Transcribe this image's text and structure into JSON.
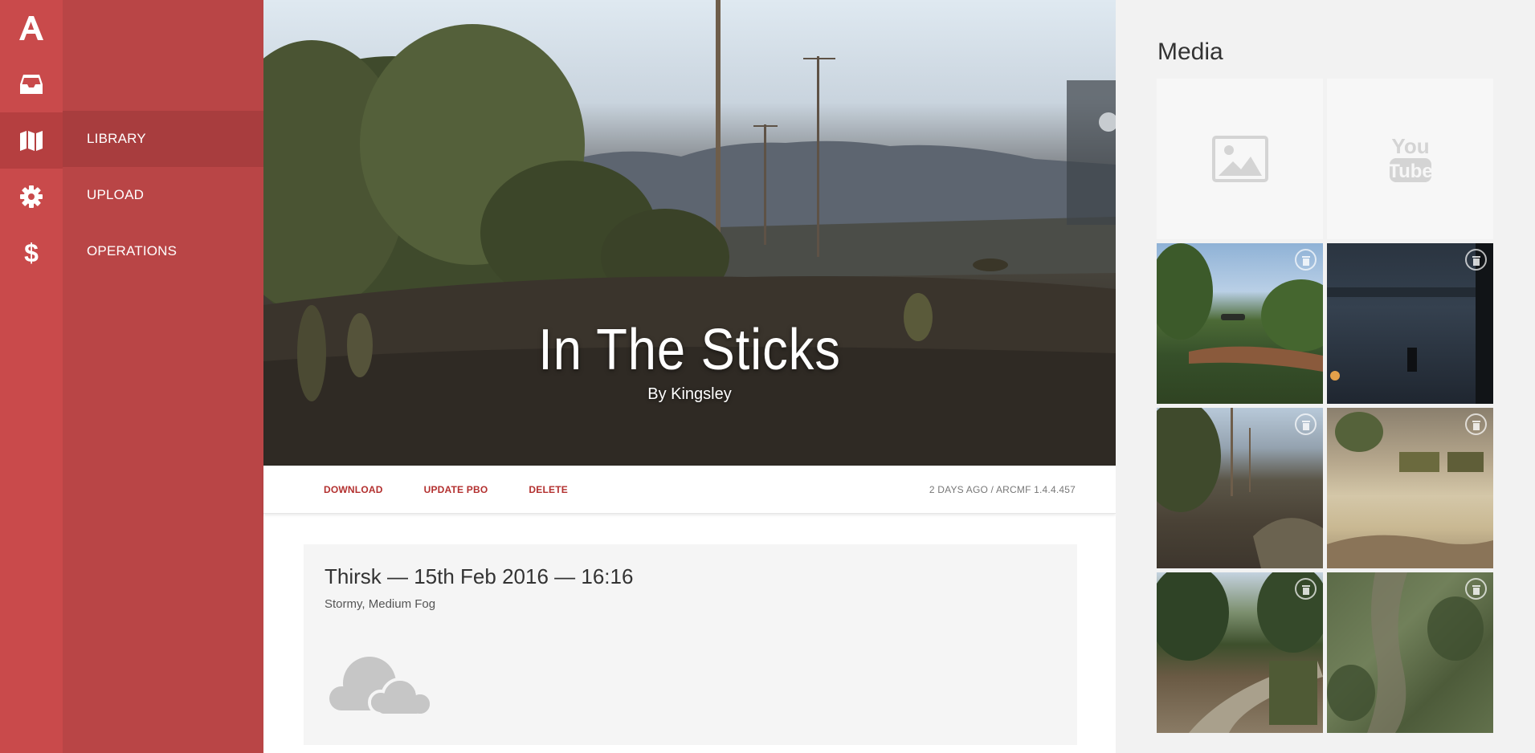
{
  "nav": {
    "items": [
      {
        "label": "LIBRARY"
      },
      {
        "label": "UPLOAD"
      },
      {
        "label": "OPERATIONS"
      }
    ]
  },
  "hero": {
    "title": "In The Sticks",
    "author": "By Kingsley"
  },
  "actions": {
    "download": "DOWNLOAD",
    "update": "UPDATE PBO",
    "delete": "DELETE",
    "meta": "2 DAYS AGO / ARCMF 1.4.4.457"
  },
  "mission": {
    "title": "Thirsk — 15th Feb 2016 — 16:16",
    "weather": "Stormy, Medium Fog"
  },
  "media": {
    "title": "Media"
  },
  "colors": {
    "rail": "#c94a4b",
    "nav_panel": "#b94546",
    "accent": "#b3302f"
  }
}
